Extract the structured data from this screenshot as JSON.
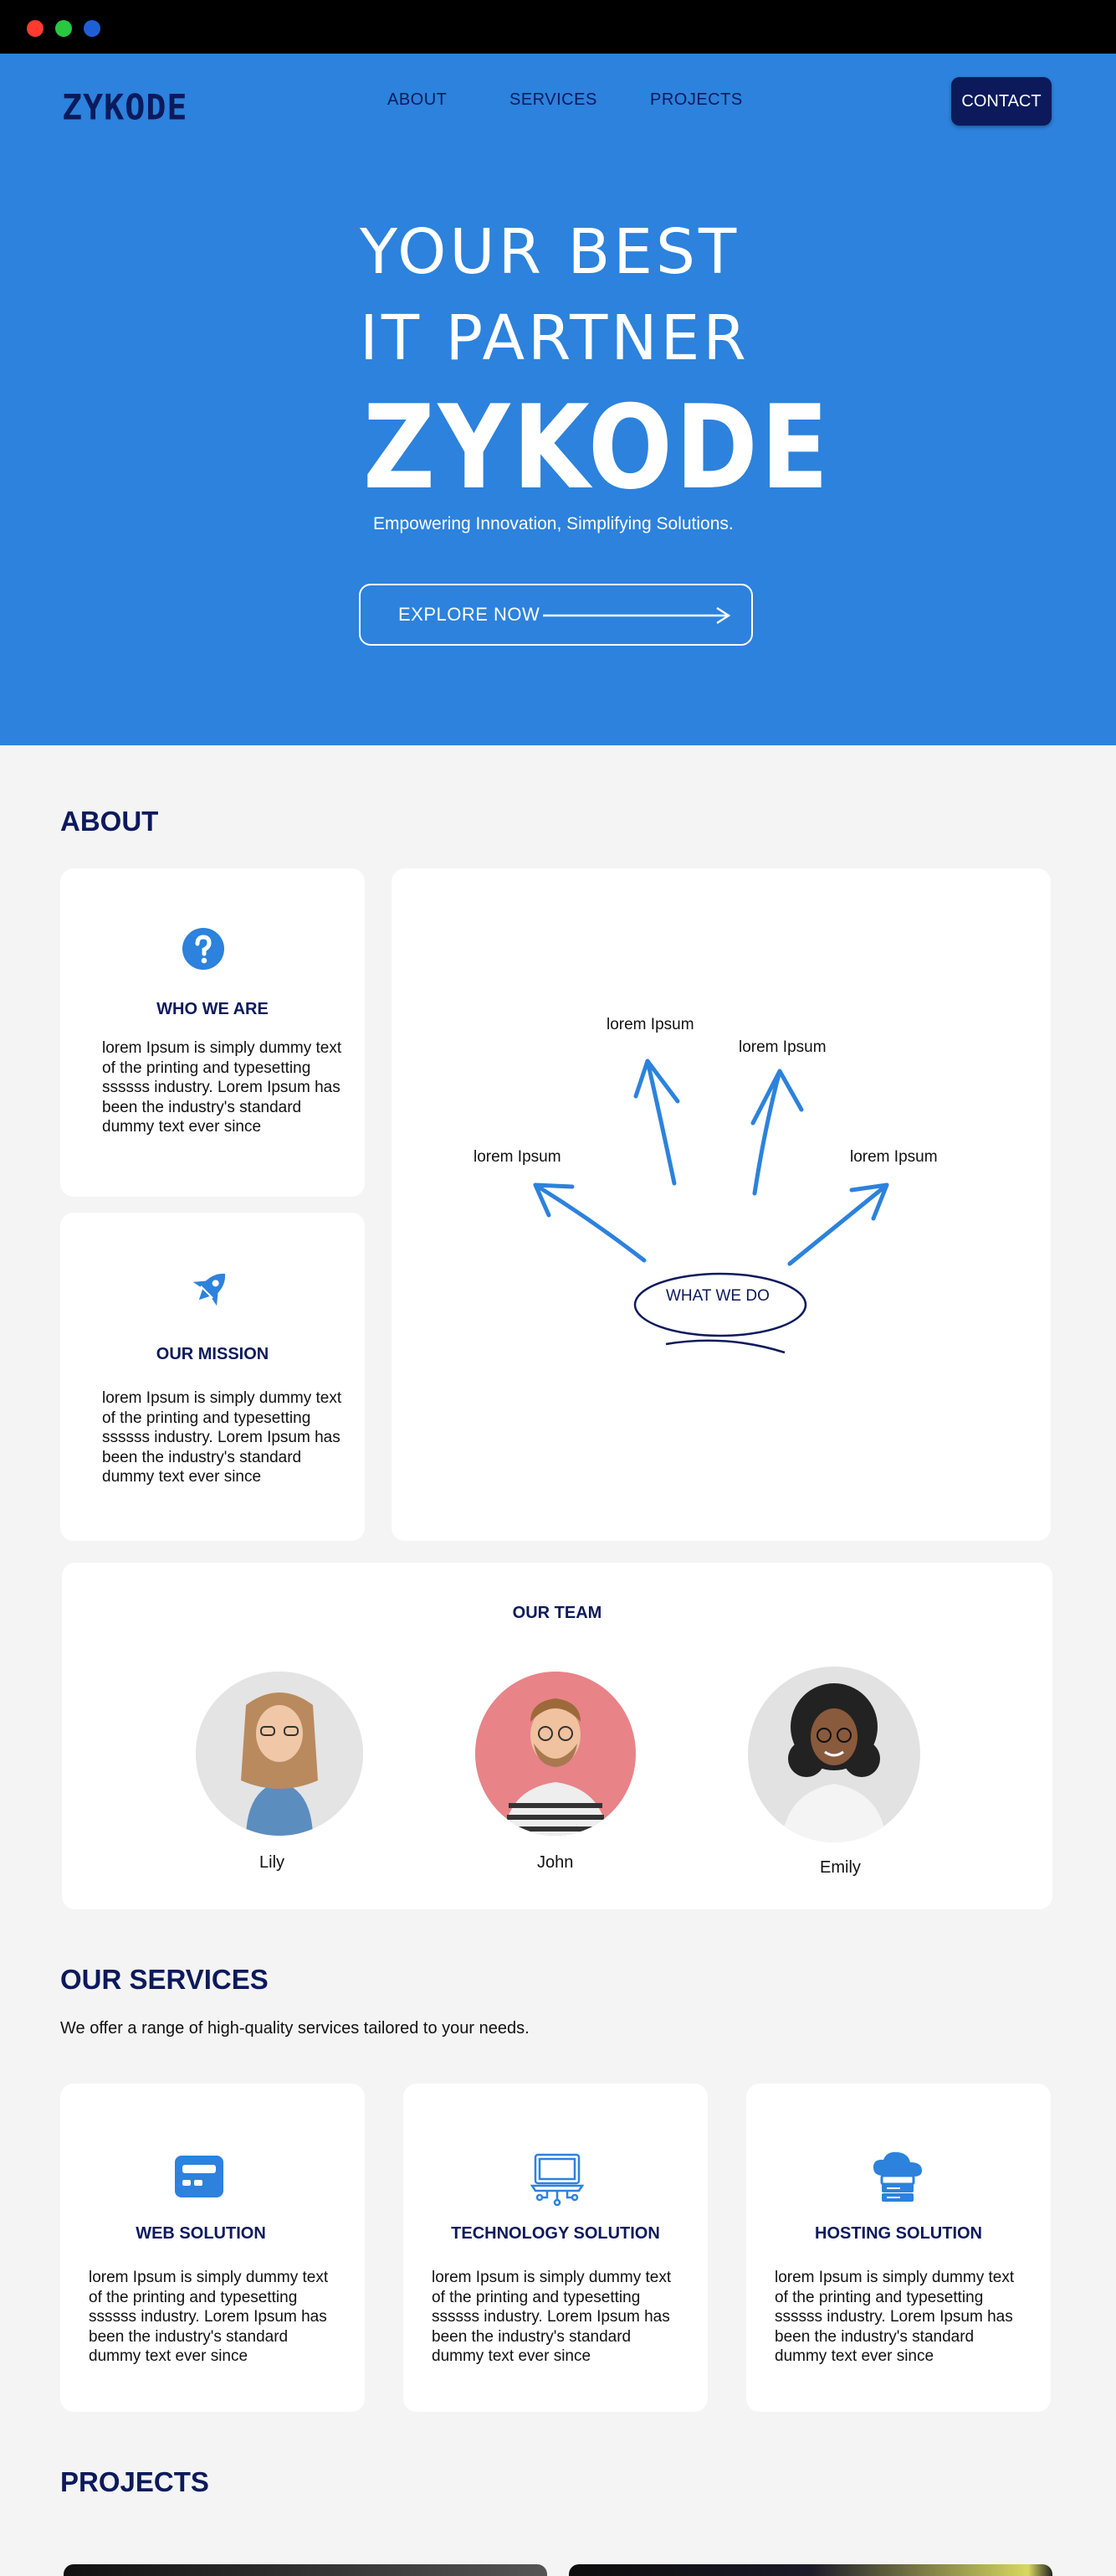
{
  "window": {
    "dots": [
      "#ff3b30",
      "#28c840",
      "#1f5fd6"
    ]
  },
  "brand": "ZYKODE",
  "nav": {
    "about": "ABOUT",
    "services": "SERVICES",
    "projects": "PROJECTS",
    "contact": "CONTACT"
  },
  "hero": {
    "line1": "YOUR BEST",
    "line2": "IT PARTNER",
    "brand": "ZYKODE",
    "tagline": "Empowering Innovation, Simplifying Solutions.",
    "cta": "EXPLORE NOW"
  },
  "about": {
    "title": "ABOUT",
    "who": {
      "title": "WHO WE ARE",
      "text": "lorem Ipsum is simply dummy text of the printing and typesetting ssssss industry. Lorem Ipsum has been the industry's standard dummy text ever since"
    },
    "mission": {
      "title": "OUR MISSION",
      "text": "lorem Ipsum is simply dummy text of the printing and typesetting ssssss industry. Lorem Ipsum has been the industry's standard dummy text ever since"
    },
    "diagram": {
      "center": "WHAT WE DO",
      "labels": [
        "lorem Ipsum",
        "lorem Ipsum",
        "lorem Ipsum",
        "lorem Ipsum"
      ]
    }
  },
  "team": {
    "title": "OUR TEAM",
    "members": [
      {
        "name": "Lily"
      },
      {
        "name": "John"
      },
      {
        "name": "Emily"
      }
    ]
  },
  "services": {
    "title": "OUR SERVICES",
    "subtitle": "We offer a range of high-quality services tailored to your needs.",
    "items": [
      {
        "title": "WEB SOLUTION",
        "icon": "web-window-icon",
        "text": "lorem Ipsum is simply dummy text of the printing and typesetting ssssss industry. Lorem Ipsum has been the industry's standard dummy text ever since"
      },
      {
        "title": "TECHNOLOGY SOLUTION",
        "icon": "laptop-circuit-icon",
        "text": "lorem Ipsum is simply dummy text of the printing and typesetting ssssss industry. Lorem Ipsum has been the industry's standard dummy text ever since"
      },
      {
        "title": "HOSTING SOLUTION",
        "icon": "cloud-server-icon",
        "text": "lorem Ipsum is simply dummy text of the printing and typesetting ssssss industry. Lorem Ipsum has been the industry's standard dummy text ever since"
      }
    ]
  },
  "projects": {
    "title": "PROJECTS"
  },
  "colors": {
    "primary": "#2c82dc",
    "navy": "#0c1a5c",
    "background": "#f4f4f4"
  }
}
